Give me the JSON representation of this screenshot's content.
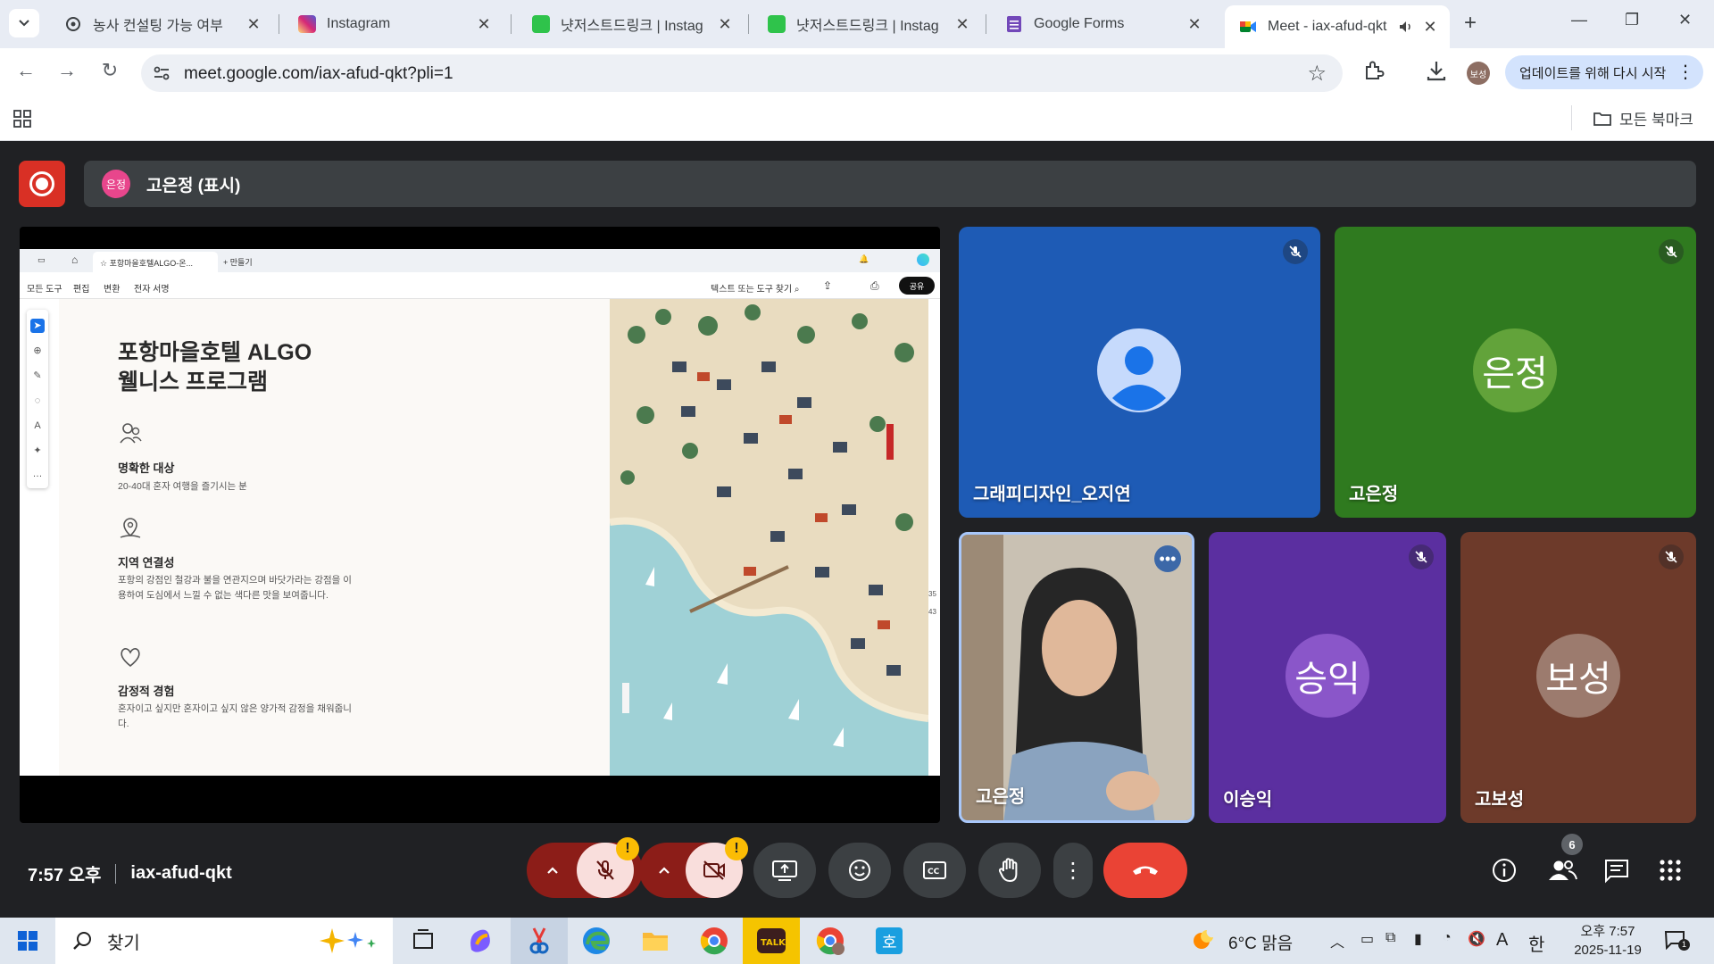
{
  "browser": {
    "tabs": [
      {
        "title": "농사 컨설팅 가능 여부",
        "favicon": "openai-icon"
      },
      {
        "title": "Instagram",
        "favicon": "instagram-icon"
      },
      {
        "title": "냣저스트드링크 | Instag",
        "favicon": "green-app-icon"
      },
      {
        "title": "냣저스트드링크 | Instag",
        "favicon": "green-app-icon"
      },
      {
        "title": "Google Forms",
        "favicon": "forms-icon"
      },
      {
        "title": "Meet - iax-afud-qkt",
        "favicon": "meet-icon",
        "active": true
      }
    ],
    "url": "meet.google.com/iax-afud-qkt?pli=1",
    "profile_label": "보성",
    "update_button": "업데이트를 위해 다시 시작",
    "bookmarks_folder": "모든 북마크"
  },
  "meet": {
    "presenter_avatar": "은정",
    "presenter_label": "고은정 (표시)",
    "time": "7:57 오후",
    "meeting_code": "iax-afud-qkt",
    "people_count": "6",
    "participants": [
      {
        "name": "그래피디자인_오지연",
        "avatar": "",
        "bg": "#1e5bb5"
      },
      {
        "name": "고은정",
        "avatar": "은정",
        "bg": "#2f7a1f"
      },
      {
        "name": "고은정",
        "avatar": "",
        "bg": "#7d8896"
      },
      {
        "name": "이승익",
        "avatar": "승익",
        "bg": "#5b2fa0"
      },
      {
        "name": "고보성",
        "avatar": "보성",
        "bg": "#6d3a2a"
      }
    ],
    "warning_mark": "!"
  },
  "shared_screen": {
    "tab_title": "포항마을호텔ALGO-온...",
    "new_tab": "+ 만들기",
    "menus": [
      "모든 도구",
      "편집",
      "변환",
      "전자 서명"
    ],
    "search_label": "텍스트 또는 도구 찾기",
    "share_button": "공유",
    "doc_title_line1": "포항마을호텔 ALGO",
    "doc_title_line2": "웰니스 프로그램",
    "sections": [
      {
        "heading": "명확한 대상",
        "body": "20-40대 혼자 여행을 즐기시는 분"
      },
      {
        "heading": "지역 연결성",
        "body": "포항의 강점인 철강과 불을 연관지으며 바닷가라는 강점을 이용하여 도심에서 느낄 수 없는 색다른 맛을 보여줍니다."
      },
      {
        "heading": "감정적 경험",
        "body": "혼자이고 싶지만 혼자이고 싶지 않은 양가적 감정을 채워줍니다."
      }
    ],
    "page_numbers": [
      "35",
      "43"
    ]
  },
  "taskbar": {
    "search_placeholder": "찾기",
    "weather": "6°C  맑음",
    "input_lang": "A",
    "ime": "한",
    "clock_time": "오후 7:57",
    "clock_date": "2025-11-19",
    "notif_count": "1"
  },
  "colors": {
    "meet_bg": "#202124",
    "hangup": "#ea4335",
    "mic_cam_off": "#f9dedc",
    "rec": "#d93025",
    "presenter_avatar": "#e8468c"
  }
}
